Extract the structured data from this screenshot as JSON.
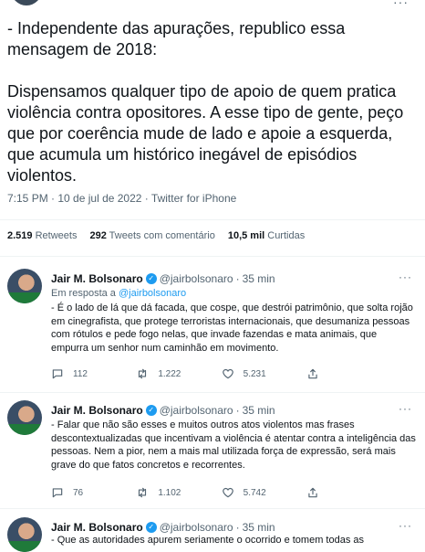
{
  "tweet": {
    "text": "- Independente das apurações, republico essa mensagem de 2018:\n\nDispensamos qualquer tipo de apoio de quem pratica violência contra opositores. A esse tipo de gente, peço que por coerência mude de lado e apoie a esquerda, que acumula um histórico inegável de episódios violentos.",
    "time": "7:15 PM",
    "date": "10 de jul de 2022",
    "source": "Twitter for iPhone"
  },
  "stats": {
    "retweets_count": "2.519",
    "retweets_label": "Retweets",
    "quotes_count": "292",
    "quotes_label": "Tweets com comentário",
    "likes_count": "10,5 mil",
    "likes_label": "Curtidas"
  },
  "replies": [
    {
      "name": "Jair M. Bolsonaro",
      "handle": "@jairbolsonaro",
      "time": "35 min",
      "replying_prefix": "Em resposta a",
      "replying_to": "@jairbolsonaro",
      "text": "- É o lado de lá que dá facada, que cospe, que destrói patrimônio, que solta rojão em cinegrafista, que protege terroristas internacionais, que desumaniza pessoas com rótulos e pede fogo nelas, que invade fazendas e mata animais, que empurra um senhor num caminhão em movimento.",
      "replies": "112",
      "retweets": "1.222",
      "likes": "5.231"
    },
    {
      "name": "Jair M. Bolsonaro",
      "handle": "@jairbolsonaro",
      "time": "35 min",
      "text": "- Falar que não são esses e muitos outros atos violentos mas frases descontextualizadas que incentivam a violência é atentar contra a inteligência das pessoas. Nem a pior, nem a mais mal utilizada força de expressão, será mais grave do que fatos concretos e recorrentes.",
      "replies": "76",
      "retweets": "1.102",
      "likes": "5.742"
    },
    {
      "name": "Jair M. Bolsonaro",
      "handle": "@jairbolsonaro",
      "time": "35 min",
      "text": "- Que as autoridades apurem seriamente o ocorrido e tomem todas as"
    }
  ],
  "icons": {
    "reply": "comment-icon",
    "retweet": "retweet-icon",
    "like": "heart-icon",
    "share": "share-icon",
    "more": "more-icon",
    "verified": "verified-icon"
  },
  "colors": {
    "accent": "#1d9bf0",
    "muted": "#536471"
  }
}
